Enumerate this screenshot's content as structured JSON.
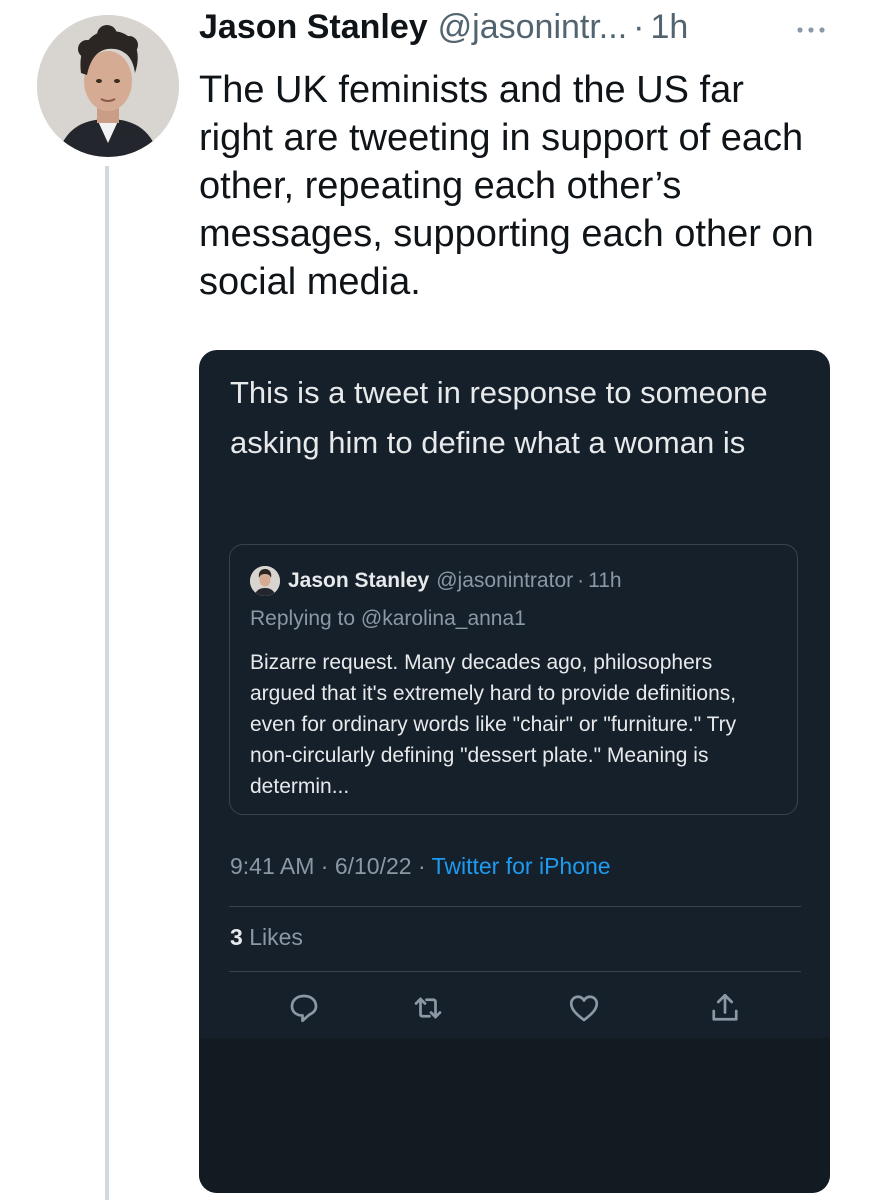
{
  "tweet": {
    "author_name": "Jason Stanley",
    "author_handle": "@jasonintr...",
    "separator": "·",
    "time": "1h",
    "text": "The UK feminists and the US far right are tweeting in support of each other, repeating each other’s messages, supporting each other on social media."
  },
  "screenshot": {
    "caption": "This is a tweet in response to someone asking him to define what a woman is",
    "quoted": {
      "author_name": "Jason Stanley",
      "author_handle": "@jasonintrator",
      "separator": "·",
      "time": "11h",
      "replying_prefix": "Replying to",
      "replying_handle": "@karolina_anna1",
      "text": "Bizarre request. Many decades ago, philosophers argued that it's extremely hard to provide definitions, even for ordinary words like \"chair\" or \"furniture.\" Try non-circularly defining \"dessert plate.\" Meaning is determin..."
    },
    "timestamp": "9:41 AM · 6/10/22 ·",
    "source": "Twitter for iPhone",
    "likes_count": "3",
    "likes_label": "Likes"
  },
  "icons": {
    "more": "more-horizontal-icon",
    "reply": "reply-icon",
    "retweet": "retweet-icon",
    "like": "heart-icon",
    "share": "share-icon"
  },
  "colors": {
    "dark_bg": "#15202b",
    "accent": "#1d9bf0",
    "muted": "#536471",
    "thread_line": "#cfd9de"
  }
}
